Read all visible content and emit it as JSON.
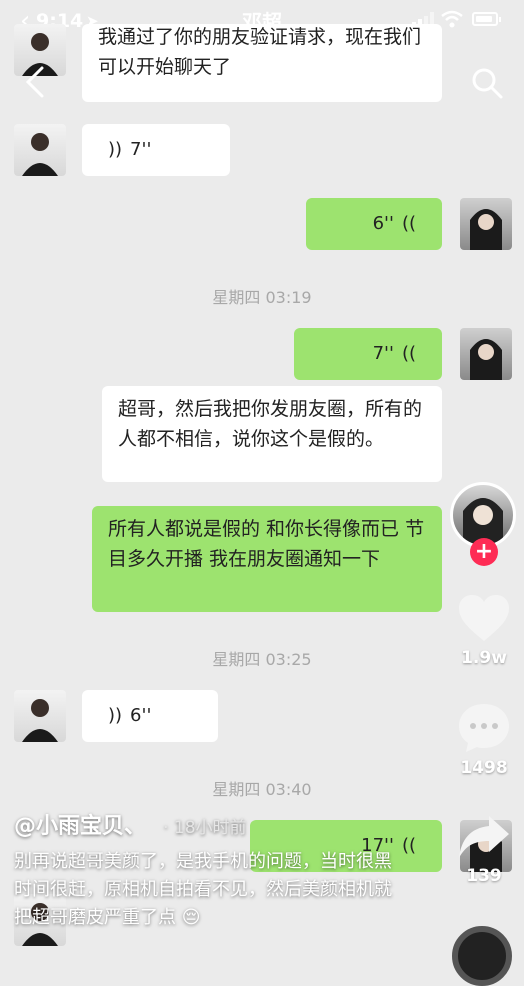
{
  "status_bar": {
    "time": "9:14"
  },
  "chat": {
    "title": "邓超",
    "messages": [
      {
        "text": "我通过了你的朋友验证请求，现在我们可以开始聊天了"
      },
      {
        "duration": "7''"
      },
      {
        "duration": "6''"
      },
      {
        "timestamp": "星期四 03:19"
      },
      {
        "duration": "7''"
      },
      {
        "text": "超哥，然后我把你发朋友圈，所有的人都不相信，说你这个是假的。"
      },
      {
        "text": "所有人都说是假的 和你长得像而已 节目多久开播 我在朋友圈通知一下"
      },
      {
        "timestamp": "星期四 03:25"
      },
      {
        "duration": "6''"
      },
      {
        "timestamp": "星期四 03:40"
      },
      {
        "duration": "17''"
      }
    ]
  },
  "side_rail": {
    "like_count": "1.9w",
    "comment_count": "1498",
    "share_count": "139"
  },
  "caption": {
    "username": "@小雨宝贝、",
    "time_ago": "· 18小时前",
    "text": "别再说超哥美颜了，是我手机的问题，当时很黑时间很赶，原相机自拍看不见，然后美颜相机就把超哥磨皮严重了点 😔"
  }
}
